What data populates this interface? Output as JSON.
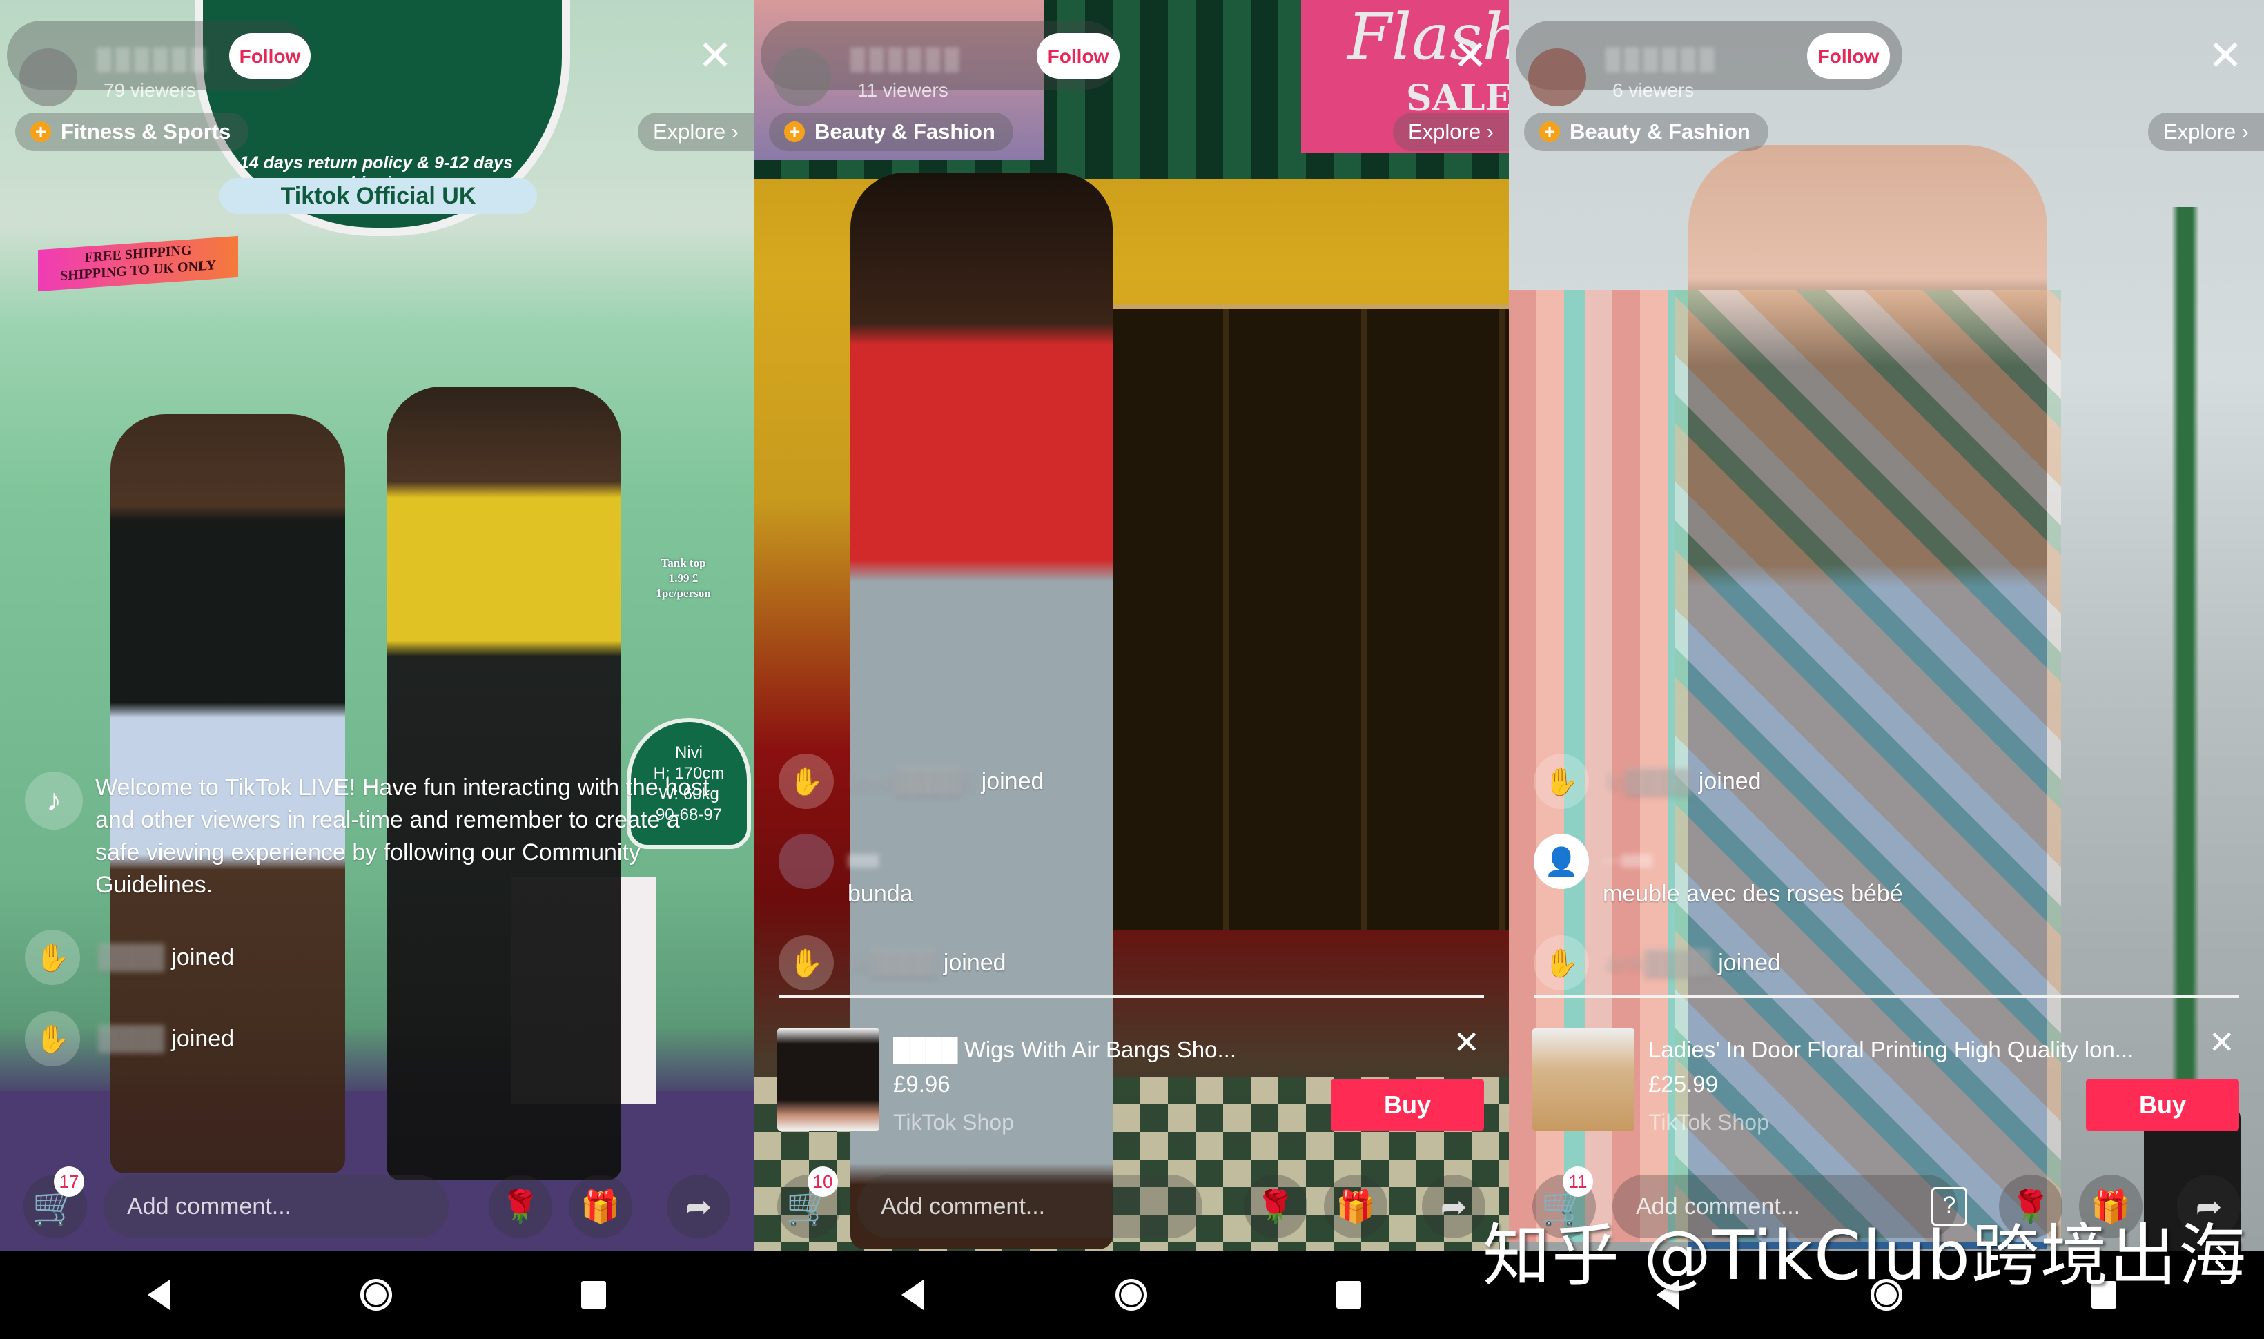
{
  "panels": [
    {
      "host": {
        "viewers": "79 viewers",
        "follow_label": "Follow"
      },
      "category": "Fitness & Sports",
      "explore_label": "Explore ›",
      "scene_text": {
        "badge_line": "14 days return policy & 9-12 days shipping",
        "badge_button": "Tiktok Official UK",
        "shipping_tag": [
          "FREE SHIPPING",
          "SHIPPING TO UK ONLY"
        ],
        "tank_top": [
          "Tank top",
          "1.99 £",
          "1pc/person"
        ],
        "model_info": [
          "Nivi",
          "H: 170cm",
          "W: 60kg",
          "90-68-97"
        ]
      },
      "welcome_message": "Welcome to TikTok LIVE! Have fun interacting with the host and other viewers in real-time and remember to create a safe viewing experience by following our Community Guidelines.",
      "messages": [
        {
          "type": "joined",
          "user": "████",
          "text": "joined"
        },
        {
          "type": "joined",
          "user": "████",
          "text": "joined"
        }
      ],
      "cart_count": "17",
      "comment_placeholder": "Add comment..."
    },
    {
      "host": {
        "viewers": "11 viewers",
        "follow_label": "Follow"
      },
      "category": "Beauty & Fashion",
      "explore_label": "Explore ›",
      "scene_text": {
        "flash_1": "Flash",
        "flash_2": "SALE!"
      },
      "messages": [
        {
          "type": "joined",
          "user": "love████6",
          "text": "joined"
        },
        {
          "type": "comment",
          "user": "████",
          "text": "bunda"
        },
        {
          "type": "joined",
          "user": "le████",
          "text": "joined"
        }
      ],
      "product": {
        "title": "████ Wigs With Air Bangs Sho...",
        "price": "£9.96",
        "shop": "TikTok Shop",
        "buy_label": "Buy"
      },
      "cart_count": "10",
      "comment_placeholder": "Add comment..."
    },
    {
      "host": {
        "viewers": "6 viewers",
        "follow_label": "Follow"
      },
      "category": "Beauty & Fashion",
      "explore_label": "Explore ›",
      "messages": [
        {
          "type": "joined",
          "user": "lo████",
          "text": "joined"
        },
        {
          "type": "comment",
          "user": "ben████",
          "text": "meuble avec des roses bébé"
        },
        {
          "type": "joined",
          "user": "ank████",
          "text": "joined"
        }
      ],
      "product": {
        "title": "Ladies' In Door Floral Printing High Quality lon...",
        "price": "£25.99",
        "shop": "TikTok Shop",
        "buy_label": "Buy"
      },
      "cart_count": "11",
      "comment_placeholder": "Add comment..."
    }
  ],
  "icons": {
    "close": "✕",
    "plus": "+",
    "wave": "✋",
    "tiktok": "♪",
    "cart": "🛒",
    "rose": "🌹",
    "gift": "🎁",
    "share": "➦",
    "help": "?",
    "user": "👤"
  },
  "watermark": "知乎 @TikClub跨境出海",
  "colors": {
    "follow_text": "#e5285a",
    "buy_button": "#fe2c55",
    "plus_badge": "#f6a11a"
  }
}
